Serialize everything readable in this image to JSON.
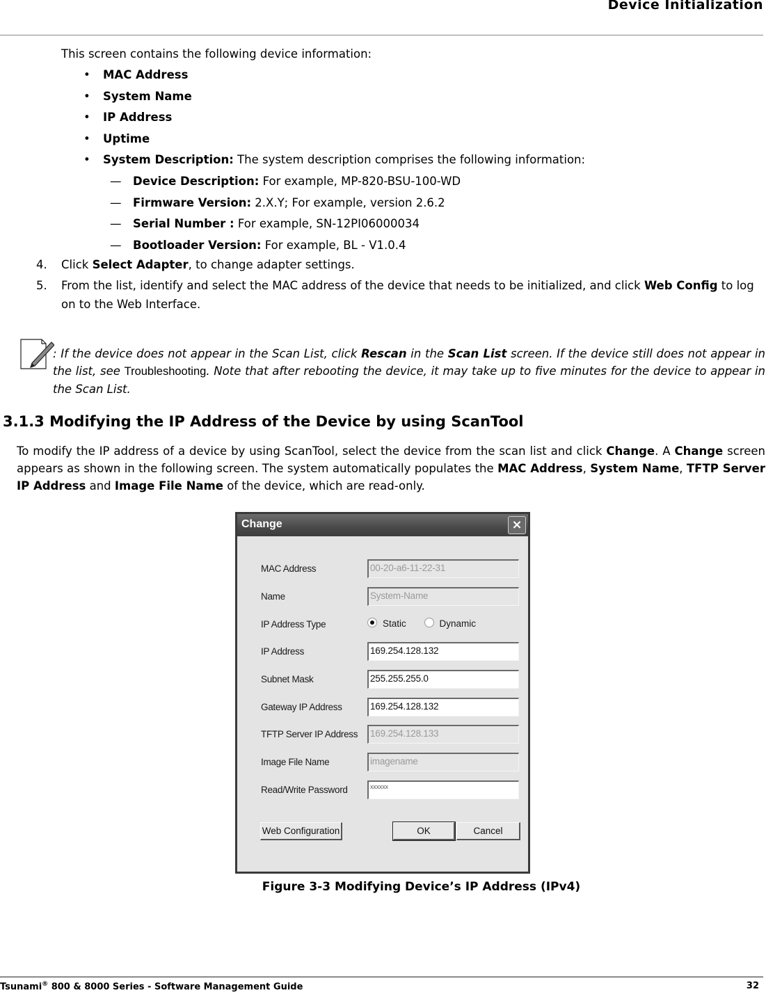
{
  "header": {
    "title": "Device Initialization"
  },
  "intro": "This screen contains the following device information:",
  "bullets": [
    {
      "bold": "MAC Address",
      "text": ""
    },
    {
      "bold": "System Name",
      "text": ""
    },
    {
      "bold": "IP Address",
      "text": ""
    },
    {
      "bold": "Uptime",
      "text": ""
    },
    {
      "bold": "System Description:",
      "text": " The system description comprises the following information:"
    }
  ],
  "bullet_glyph": "•",
  "dash_glyph": "—",
  "sub_items": [
    {
      "bold": "Device Description:",
      "text": " For example, MP-820-BSU-100-WD"
    },
    {
      "bold": "Firmware Version:",
      "text": " 2.X.Y; For example, version 2.6.2"
    },
    {
      "bold": "Serial Number :",
      "text": " For example, SN-12PI06000034"
    },
    {
      "bold": "Bootloader Version:",
      "text": " For example, BL - V1.0.4"
    }
  ],
  "steps": [
    {
      "num": "4.",
      "pre": "Click ",
      "bold": "Select Adapter",
      "post": ", to change adapter settings."
    },
    {
      "num": "5.",
      "pre": "From the list, identify and select the MAC address of the device that needs to be initialized, and click ",
      "bold": "Web Config",
      "post": " to log on to the Web Interface."
    }
  ],
  "note": {
    "icon": "note-pencil-icon",
    "t1": ": If the device does not appear in the Scan List, click ",
    "b1": "Rescan",
    "t2": " in the ",
    "b2": "Scan List",
    "t3": " screen. If the device still does not appear in the list, see ",
    "link": "Troubleshooting",
    "t4": ". Note that after rebooting the device, it may take up to five minutes for the device to appear in the Scan List."
  },
  "section": {
    "heading": "3.1.3 Modifying the IP Address of the Device by using ScanTool",
    "p1": "To modify the IP address of a device by using ScanTool, select the device from the scan list and click ",
    "b1": "Change",
    "p2": ". A ",
    "b2": "Change",
    "p3": " screen appears as shown in the following screen. The system automatically populates the ",
    "b3": "MAC Address",
    "p4": ", ",
    "b4": "System Name",
    "p5": ", ",
    "b5": "TFTP Server IP Address",
    "p6": " and ",
    "b6": "Image File Name",
    "p7": " of the device, which are read-only."
  },
  "dialog": {
    "title": "Change",
    "close_icon": "×",
    "fields": {
      "mac": {
        "label": "MAC Address",
        "value": "00-20-a6-11-22-31"
      },
      "name": {
        "label": "Name",
        "value": "System-Name"
      },
      "ip_type": {
        "label": "IP Address Type",
        "options": [
          "Static",
          "Dynamic"
        ],
        "selected": "Static"
      },
      "ip": {
        "label": "IP Address",
        "value": "169.254.128.132"
      },
      "mask": {
        "label": "Subnet Mask",
        "value": "255.255.255.0"
      },
      "gateway": {
        "label": "Gateway IP Address",
        "value": "169.254.128.132"
      },
      "tftp": {
        "label": "TFTP Server IP Address",
        "value": "169.254.128.133"
      },
      "image": {
        "label": "Image File Name",
        "value": "imagename"
      },
      "password": {
        "label": "Read/Write Password",
        "value": "xxxxxx"
      }
    },
    "buttons": {
      "web_config": "Web Configuration",
      "ok": "OK",
      "cancel": "Cancel"
    }
  },
  "caption": "Figure 3-3 Modifying Device’s IP Address (IPv4)",
  "footer": {
    "left_pre": "Tsunami",
    "reg": "®",
    "left_post": " 800 & 8000 Series - Software Management Guide",
    "page": "32"
  }
}
